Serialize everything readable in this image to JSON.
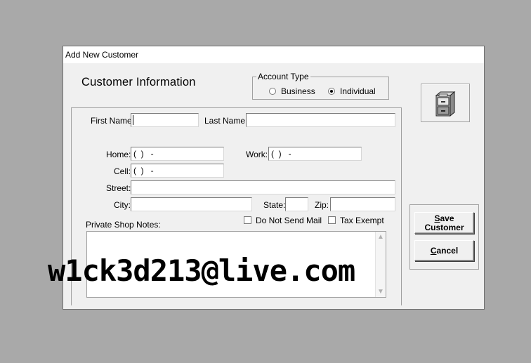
{
  "window": {
    "title": "Add New Customer"
  },
  "form": {
    "heading": "Customer Information"
  },
  "account_type": {
    "legend": "Account Type",
    "options": [
      {
        "label": "Business",
        "selected": false
      },
      {
        "label": "Individual",
        "selected": true
      }
    ]
  },
  "fields": {
    "first_name": {
      "label": "First Name:",
      "value": ""
    },
    "last_name": {
      "label": "Last Name:",
      "value": ""
    },
    "home": {
      "label": "Home:",
      "value": "(  )   -"
    },
    "work": {
      "label": "Work:",
      "value": "(  )   -"
    },
    "cell": {
      "label": "Cell:",
      "value": "(  )   -"
    },
    "street": {
      "label": "Street:",
      "value": ""
    },
    "city": {
      "label": "City:",
      "value": ""
    },
    "state": {
      "label": "State:",
      "value": ""
    },
    "zip": {
      "label": "Zip:",
      "value": ""
    }
  },
  "checkboxes": {
    "do_not_send_mail": {
      "label": "Do Not Send Mail",
      "checked": false
    },
    "tax_exempt": {
      "label": "Tax Exempt",
      "checked": false
    }
  },
  "notes": {
    "label": "Private Shop Notes:",
    "value": ""
  },
  "buttons": {
    "save_line1": "Save",
    "save_line2": "Customer",
    "cancel": "Cancel"
  },
  "icons": {
    "toolbar_icon": "file-cabinet-icon"
  },
  "watermark": {
    "text": "w1ck3d213@live.com"
  }
}
